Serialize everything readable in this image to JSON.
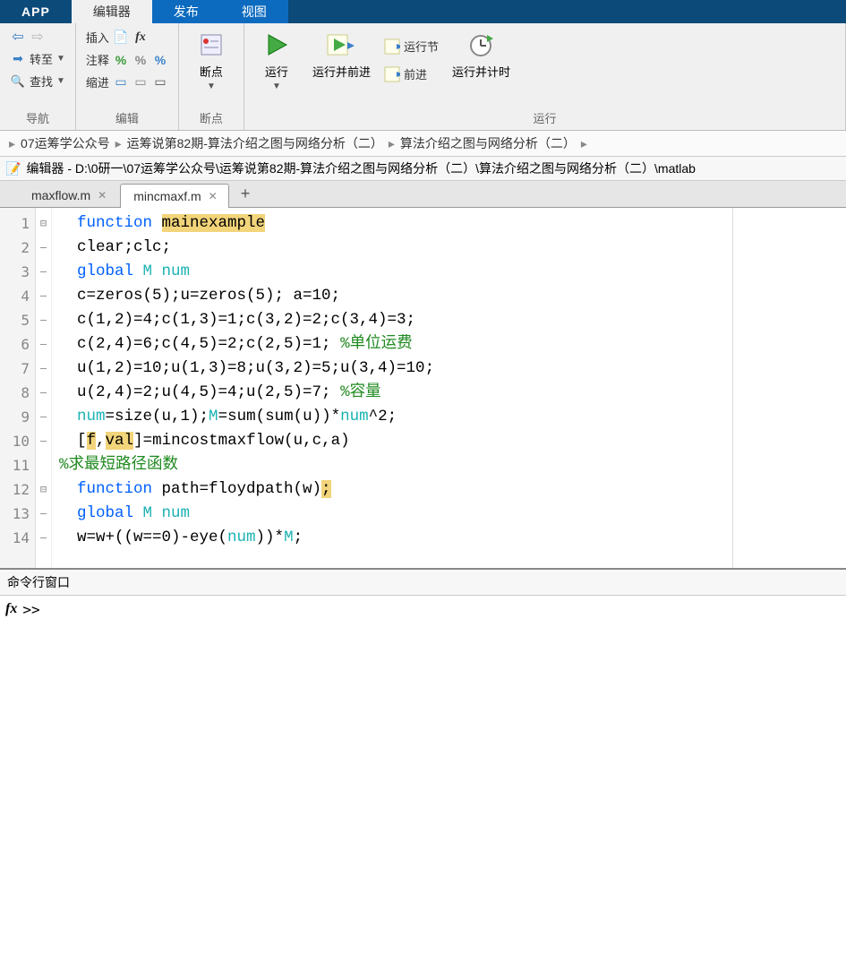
{
  "topTabs": {
    "app": "APP",
    "editor": "编辑器",
    "publish": "发布",
    "view": "视图"
  },
  "ribbon": {
    "nav": {
      "goto": "转至",
      "find": "查找",
      "label": "导航"
    },
    "edit": {
      "insert": "插入",
      "comment": "注释",
      "indent": "缩进",
      "label": "编辑"
    },
    "breakpoints": {
      "button": "断点",
      "label": "断点"
    },
    "run": {
      "run": "运行",
      "runAdvance": "运行并前进",
      "runSection": "运行节",
      "advance": "前进",
      "runTime": "运行并计时",
      "label": "运行"
    }
  },
  "breadcrumb": {
    "a": "07运筹学公众号",
    "b": "运筹说第82期-算法介绍之图与网络分析（二）",
    "c": "算法介绍之图与网络分析（二）"
  },
  "title": "编辑器 - D:\\0研一\\07运筹学公众号\\运筹说第82期-算法介绍之图与网络分析（二）\\算法介绍之图与网络分析（二）\\matlab",
  "fileTabs": {
    "a": "maxflow.m",
    "b": "mincmaxf.m"
  },
  "code": {
    "lines": [
      {
        "n": 1,
        "fold": "⊟",
        "dash": false,
        "parts": [
          {
            "t": "function ",
            "c": "kw"
          },
          {
            "t": "mainexample",
            "c": "hl"
          }
        ]
      },
      {
        "n": 2,
        "fold": "",
        "dash": true,
        "parts": [
          {
            "t": "clear;clc;",
            "c": ""
          }
        ]
      },
      {
        "n": 3,
        "fold": "",
        "dash": true,
        "parts": [
          {
            "t": "global ",
            "c": "kw"
          },
          {
            "t": "M num",
            "c": "num-local"
          }
        ]
      },
      {
        "n": 4,
        "fold": "",
        "dash": true,
        "parts": [
          {
            "t": "c=zeros(5);u=zeros(5); a=10;",
            "c": ""
          }
        ]
      },
      {
        "n": 5,
        "fold": "",
        "dash": true,
        "parts": [
          {
            "t": "c(1,2)=4;c(1,3)=1;c(3,2)=2;c(3,4)=3;",
            "c": ""
          }
        ]
      },
      {
        "n": 6,
        "fold": "",
        "dash": true,
        "parts": [
          {
            "t": "c(2,4)=6;c(4,5)=2;c(2,5)=1; ",
            "c": ""
          },
          {
            "t": "%单位运费",
            "c": "com"
          }
        ]
      },
      {
        "n": 7,
        "fold": "",
        "dash": true,
        "parts": [
          {
            "t": "u(1,2)=10;u(1,3)=8;u(3,2)=5;u(3,4)=10;",
            "c": ""
          }
        ]
      },
      {
        "n": 8,
        "fold": "",
        "dash": true,
        "parts": [
          {
            "t": "u(2,4)=2;u(4,5)=4;u(2,5)=7; ",
            "c": ""
          },
          {
            "t": "%容量",
            "c": "com"
          }
        ]
      },
      {
        "n": 9,
        "fold": "",
        "dash": true,
        "parts": [
          {
            "t": "num",
            "c": "num-local"
          },
          {
            "t": "=size(u,1);",
            "c": ""
          },
          {
            "t": "M",
            "c": "num-local"
          },
          {
            "t": "=sum(sum(u))*",
            "c": ""
          },
          {
            "t": "num",
            "c": "num-local"
          },
          {
            "t": "^2;",
            "c": ""
          }
        ]
      },
      {
        "n": 10,
        "fold": "",
        "dash": true,
        "parts": [
          {
            "t": "[",
            "c": ""
          },
          {
            "t": "f",
            "c": "hl"
          },
          {
            "t": ",",
            "c": ""
          },
          {
            "t": "val",
            "c": "hl"
          },
          {
            "t": "]",
            "c": ""
          },
          {
            "t": "=mincostmaxflow(u,c,a)",
            "c": ""
          }
        ]
      },
      {
        "n": 11,
        "fold": "",
        "dash": false,
        "noindent": true,
        "parts": [
          {
            "t": "%求最短路径函数",
            "c": "com"
          }
        ]
      },
      {
        "n": 12,
        "fold": "⊟",
        "dash": false,
        "parts": [
          {
            "t": "function ",
            "c": "kw"
          },
          {
            "t": "path=floydpath(w)",
            "c": ""
          },
          {
            "t": ";",
            "c": "hl"
          }
        ]
      },
      {
        "n": 13,
        "fold": "",
        "dash": true,
        "parts": [
          {
            "t": "global ",
            "c": "kw"
          },
          {
            "t": "M num",
            "c": "num-local"
          }
        ]
      },
      {
        "n": 14,
        "fold": "",
        "dash": true,
        "parts": [
          {
            "t": "w=w+((w==0)-eye(",
            "c": ""
          },
          {
            "t": "num",
            "c": "num-local"
          },
          {
            "t": "))*",
            "c": ""
          },
          {
            "t": "M",
            "c": "num-local"
          },
          {
            "t": ";",
            "c": ""
          }
        ]
      }
    ]
  },
  "cmd": {
    "header": "命令行窗口",
    "prompt": ">>"
  }
}
